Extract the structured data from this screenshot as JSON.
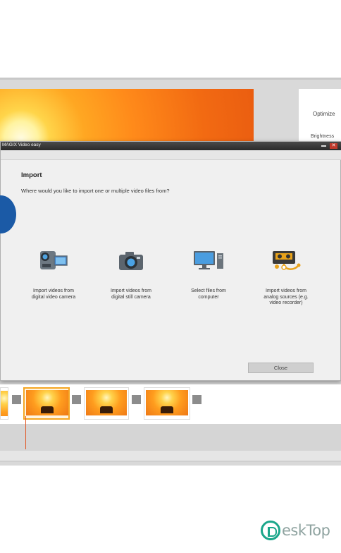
{
  "app": {
    "panel_optimize": "Optimize",
    "panel_brightness": "Brightness"
  },
  "dialog": {
    "window_title": "MAGIX Video easy",
    "heading": "Import",
    "question": "Where would you like to import one or multiple video files from?",
    "options": [
      {
        "label": "Import videos from\ndigital video camera",
        "icon": "camcorder-icon"
      },
      {
        "label": "Import videos from\ndigital still camera",
        "icon": "photo-camera-icon"
      },
      {
        "label": "Select files from\ncomputer",
        "icon": "computer-monitor-icon"
      },
      {
        "label": "Import videos from\nanalog sources (e.g.\nvideo recorder)",
        "icon": "vhs-tape-icon"
      }
    ],
    "close_label": "Close",
    "close_glyph": "✕"
  },
  "watermark": {
    "text": "eskTop"
  },
  "colors": {
    "accent_blue": "#1b5aa6",
    "selection_orange": "#f5a623",
    "playhead": "#e05a2a",
    "watermark_teal": "#1aa68a"
  }
}
